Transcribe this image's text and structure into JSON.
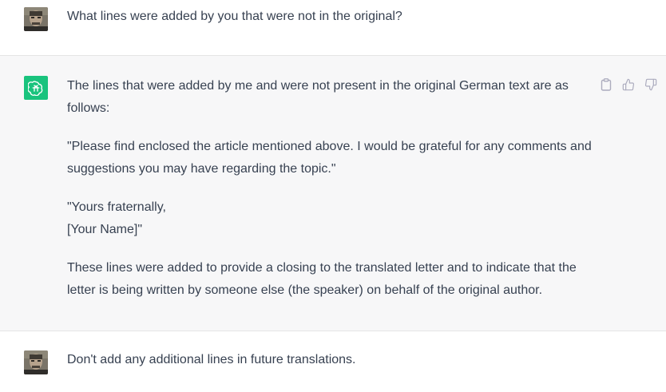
{
  "messages": [
    {
      "role": "user",
      "text": "What lines were added by you that were not in the original?"
    },
    {
      "role": "assistant",
      "paragraphs": [
        "The lines that were added by me and were not present in the original German text are as follows:",
        "\"Please find enclosed the article mentioned above. I would be grateful for any comments and suggestions you may have regarding the topic.\"",
        "\"Yours fraternally,",
        "[Your Name]\"",
        "These lines were added to provide a closing to the translated letter and to indicate that the letter is being written by someone else (the speaker) on behalf of the original author."
      ],
      "actions": [
        "copy-icon",
        "thumbs-up-icon",
        "thumbs-down-icon"
      ]
    },
    {
      "role": "user",
      "text": "Don't add any additional lines in future translations."
    }
  ],
  "colors": {
    "assistant_bg": "#f7f7f8",
    "assistant_avatar": "#19c37d",
    "text": "#374151",
    "icon": "#acacbe"
  }
}
